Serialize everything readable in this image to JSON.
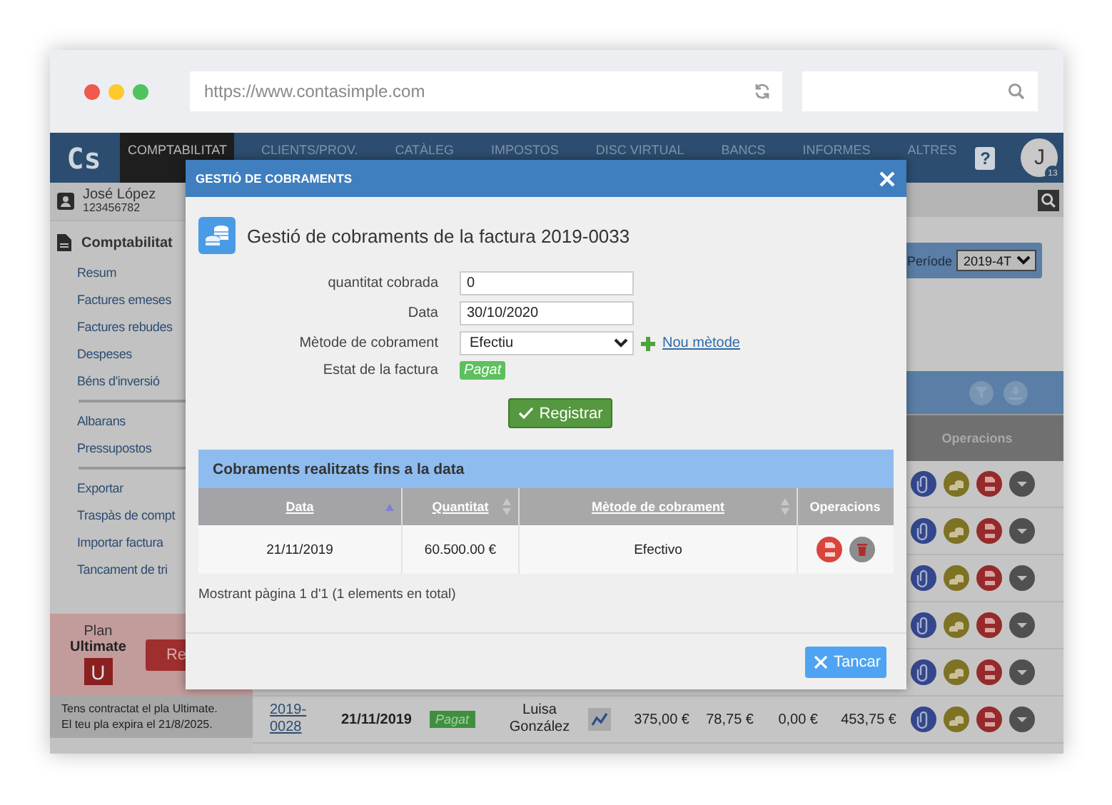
{
  "browser": {
    "url": "https://www.contasimple.com"
  },
  "app": {
    "logo": "Cs",
    "help": "?",
    "avatar": {
      "initial": "J",
      "badge": "13"
    },
    "nav": [
      {
        "label": "COMPTABILITAT",
        "selected": true
      },
      {
        "label": "CLIENTS/PROV.",
        "selected": false
      },
      {
        "label": "CATÀLEG",
        "selected": false
      },
      {
        "label": "IMPOSTOS",
        "selected": false
      },
      {
        "label": "DISC VIRTUAL",
        "selected": false
      },
      {
        "label": "BANCS",
        "selected": false
      },
      {
        "label": "INFORMES",
        "selected": false
      },
      {
        "label": "ALTRES",
        "selected": false
      }
    ]
  },
  "sidebar": {
    "user": {
      "name": "José López",
      "id": "123456782"
    },
    "section": "Comptabilitat",
    "groups": [
      {
        "items": [
          "Resum",
          "Factures emeses",
          "Factures rebudes",
          "Despeses",
          "Béns d'inversió"
        ]
      },
      {
        "items": [
          "Albarans",
          "Pressupostos"
        ]
      },
      {
        "items": [
          "Exportar",
          "Traspàs de compt",
          "Importar factura",
          "Tancament de tri"
        ]
      }
    ],
    "plan": {
      "label": "Plan",
      "name": "Ultimate",
      "badge": "U",
      "button": "Re"
    },
    "notice": [
      "Tens contractat el pla Ultimate.",
      "El teu pla expira el 21/8/2025."
    ]
  },
  "main": {
    "period": {
      "label": "Període",
      "value": "2019-4T"
    },
    "table": {
      "ops_header": "Operacions",
      "rows": [
        {
          "kind": "covered"
        },
        {
          "kind": "covered"
        },
        {
          "kind": "covered"
        },
        {
          "kind": "covered"
        },
        {
          "kind": "covered"
        },
        {
          "kind": "full",
          "number": "2019-0028",
          "date": "21/11/2019",
          "status": "Pagat",
          "client": "Luisa González",
          "amount_1": "375,00 €",
          "amount_2": "78,75 €",
          "amount_3": "0,00 €",
          "amount_4": "453,75 €"
        }
      ]
    }
  },
  "modal": {
    "title": "GESTIÓ DE COBRAMENTS",
    "heading": "Gestió de cobraments de la factura 2019-0033",
    "form": [
      {
        "kind": "input",
        "label": "quantitat cobrada",
        "value": "0"
      },
      {
        "kind": "input",
        "label": "Data",
        "value": "30/10/2020"
      },
      {
        "kind": "select",
        "label": "Mètode de cobrament",
        "value": "Efectiu",
        "link": "Nou mètode"
      },
      {
        "kind": "badge",
        "label": "Estat de la factura",
        "value": "Pagat"
      }
    ],
    "submit": "Registrar",
    "panel": {
      "title": "Cobraments realitzats fins a la data",
      "columns": [
        {
          "label": "Data",
          "sortable": true,
          "sorted": true
        },
        {
          "label": "Quantitat",
          "sortable": true,
          "sorted": false
        },
        {
          "label": "Mètode de cobrament",
          "sortable": true,
          "sorted": false
        },
        {
          "label": "Operacions",
          "sortable": false
        }
      ],
      "rows": [
        {
          "date": "21/11/2019",
          "amount": "60.500.00 €",
          "method": "Efectivo"
        }
      ]
    },
    "pager": "Mostrant pàgina 1 d'1 (1 elements en total)",
    "close_button": "Tancar"
  }
}
